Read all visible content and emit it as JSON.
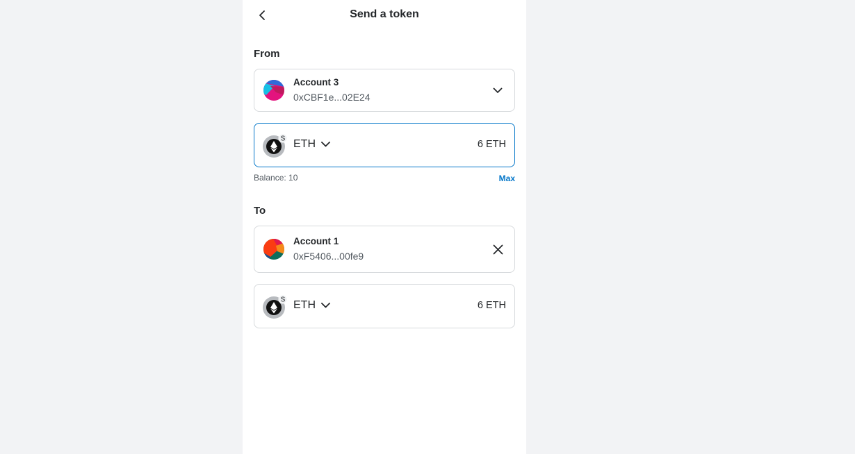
{
  "header": {
    "title": "Send a token",
    "back_icon": "chevron-left-icon"
  },
  "from": {
    "label": "From",
    "account": {
      "name": "Account 3",
      "address": "0xCBF1e...02E24",
      "action_icon": "chevron-down-icon"
    },
    "token": {
      "symbol": "ETH",
      "amount": "6 ETH",
      "network_badge": "S",
      "icon": "ethereum-icon"
    },
    "balance_text": "Balance: 10",
    "max_label": "Max"
  },
  "to": {
    "label": "To",
    "account": {
      "name": "Account 1",
      "address": "0xF5406...00fe9",
      "action_icon": "close-icon"
    },
    "token": {
      "symbol": "ETH",
      "amount": "6 ETH",
      "network_badge": "S",
      "icon": "ethereum-icon"
    }
  },
  "colors": {
    "accent": "#0376c9",
    "page_background": "#f2f3f5",
    "panel_background": "#ffffff",
    "border": "#d6d9dc",
    "text": "#24272a",
    "muted_text": "#535a61"
  }
}
